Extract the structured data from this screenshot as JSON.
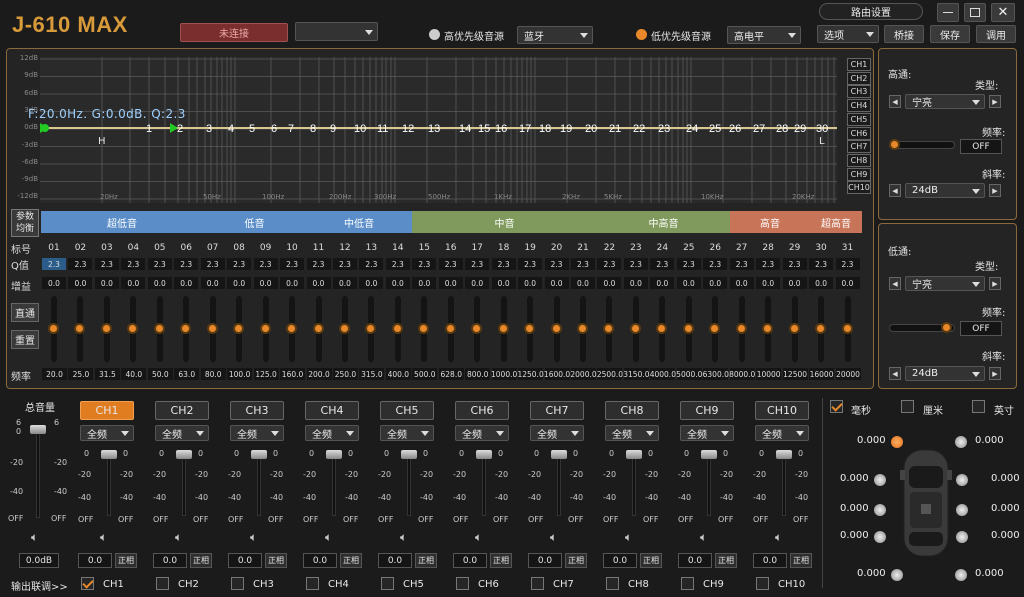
{
  "app": {
    "title": "J-610 MAX"
  },
  "top": {
    "connect": "未连接",
    "source_hi": "高优先级音源",
    "source_hi_value": "蓝牙",
    "source_lo": "低优先级音源",
    "source_lo_value": "高电平",
    "route": "路由设置",
    "options": "选项",
    "bridge": "桥接",
    "save": "保存",
    "load": "调用"
  },
  "graph": {
    "ylabels": [
      "12dB",
      "9dB",
      "6dB",
      "3dB",
      "0dB",
      "-3dB",
      "-6dB",
      "-9dB",
      "-12dB"
    ],
    "xlabels": [
      "20Hz",
      "50Hz",
      "100Hz",
      "200Hz",
      "300Hz",
      "500Hz",
      "1KHz",
      "2KHz",
      "5KHz",
      "10KHz",
      "20KHz"
    ],
    "info": "F:20.0Hz. G:0.0dB. Q:2.3",
    "H": "H",
    "L": "L",
    "channels": [
      "CH1",
      "CH2",
      "CH3",
      "CH4",
      "CH5",
      "CH6",
      "CH7",
      "CH8",
      "CH9",
      "CH10"
    ]
  },
  "eq": {
    "param_eq": "参数\n均衡",
    "bands": [
      "超低音",
      "低音",
      "中低音",
      "中音",
      "中高音",
      "高音",
      "超高音"
    ],
    "label_num": "标号",
    "label_q": "Q值",
    "label_gain": "增益",
    "label_freq": "频率",
    "bypass": "直通",
    "reset": "重置",
    "numbers": [
      "01",
      "02",
      "03",
      "04",
      "05",
      "06",
      "07",
      "08",
      "09",
      "10",
      "11",
      "12",
      "13",
      "14",
      "15",
      "16",
      "17",
      "18",
      "19",
      "20",
      "21",
      "22",
      "23",
      "24",
      "25",
      "26",
      "27",
      "28",
      "29",
      "30",
      "31"
    ],
    "q": [
      "2.3",
      "2.3",
      "2.3",
      "2.3",
      "2.3",
      "2.3",
      "2.3",
      "2.3",
      "2.3",
      "2.3",
      "2.3",
      "2.3",
      "2.3",
      "2.3",
      "2.3",
      "2.3",
      "2.3",
      "2.3",
      "2.3",
      "2.3",
      "2.3",
      "2.3",
      "2.3",
      "2.3",
      "2.3",
      "2.3",
      "2.3",
      "2.3",
      "2.3",
      "2.3",
      "2.3"
    ],
    "gain": [
      "0.0",
      "0.0",
      "0.0",
      "0.0",
      "0.0",
      "0.0",
      "0.0",
      "0.0",
      "0.0",
      "0.0",
      "0.0",
      "0.0",
      "0.0",
      "0.0",
      "0.0",
      "0.0",
      "0.0",
      "0.0",
      "0.0",
      "0.0",
      "0.0",
      "0.0",
      "0.0",
      "0.0",
      "0.0",
      "0.0",
      "0.0",
      "0.0",
      "0.0",
      "0.0",
      "0.0"
    ],
    "freq": [
      "20.0",
      "25.0",
      "31.5",
      "40.0",
      "50.0",
      "63.0",
      "80.0",
      "100.0",
      "125.0",
      "160.0",
      "200.0",
      "250.0",
      "315.0",
      "400.0",
      "500.0",
      "628.0",
      "800.0",
      "1000.0",
      "1250.0",
      "1600.0",
      "2000.0",
      "2500.0",
      "3150.0",
      "4000.0",
      "5000.0",
      "6300.0",
      "8000.0",
      "10000",
      "12500",
      "16000",
      "20000"
    ]
  },
  "hp": {
    "title": "高通:",
    "type_label": "类型:",
    "type": "宁亮",
    "freq_label": "频率:",
    "freq": "OFF",
    "slope_label": "斜率:",
    "slope": "24dB"
  },
  "lp": {
    "title": "低通:",
    "type_label": "类型:",
    "type": "宁亮",
    "freq_label": "频率:",
    "freq": "OFF",
    "slope_label": "斜率:",
    "slope": "24dB"
  },
  "master": {
    "label": "总音量",
    "value": "0.0dB",
    "scale": [
      "6",
      "0",
      "-20",
      "-40",
      "OFF"
    ]
  },
  "channels": [
    {
      "name": "CH1",
      "filter": "全频",
      "value": "0.0",
      "phase": "正相"
    },
    {
      "name": "CH2",
      "filter": "全频",
      "value": "0.0",
      "phase": "正相"
    },
    {
      "name": "CH3",
      "filter": "全频",
      "value": "0.0",
      "phase": "正相"
    },
    {
      "name": "CH4",
      "filter": "全频",
      "value": "0.0",
      "phase": "正相"
    },
    {
      "name": "CH5",
      "filter": "全频",
      "value": "0.0",
      "phase": "正相"
    },
    {
      "name": "CH6",
      "filter": "全频",
      "value": "0.0",
      "phase": "正相"
    },
    {
      "name": "CH7",
      "filter": "全频",
      "value": "0.0",
      "phase": "正相"
    },
    {
      "name": "CH8",
      "filter": "全频",
      "value": "0.0",
      "phase": "正相"
    },
    {
      "name": "CH9",
      "filter": "全频",
      "value": "0.0",
      "phase": "正相"
    },
    {
      "name": "CH10",
      "filter": "全频",
      "value": "0.0",
      "phase": "正相"
    }
  ],
  "ch_scale": [
    "0",
    "-20",
    "-40",
    "OFF"
  ],
  "link": {
    "label": "输出联调>>",
    "items": [
      "CH1",
      "CH2",
      "CH3",
      "CH4",
      "CH5",
      "CH6",
      "CH7",
      "CH8",
      "CH9",
      "CH10"
    ]
  },
  "delay": {
    "units": [
      "毫秒",
      "厘米",
      "英寸"
    ],
    "values": [
      "0.000",
      "0.000",
      "0.000",
      "0.000",
      "0.000",
      "0.000",
      "0.000",
      "0.000",
      "0.000",
      "0.000"
    ]
  },
  "colors": {
    "accent": "#e8882a",
    "eq_line": "#d8c890"
  }
}
